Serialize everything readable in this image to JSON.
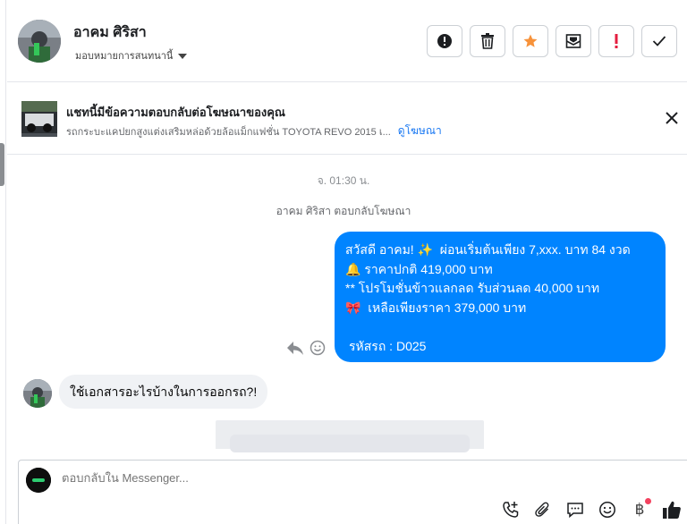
{
  "header": {
    "contact_name": "อาคม ศิริสา",
    "assign_label": "มอบหมายการสนทนานี้",
    "toolbar": [
      {
        "name": "follow-up-button",
        "icon": "exclamation-circle-icon"
      },
      {
        "name": "delete-button",
        "icon": "trash-icon"
      },
      {
        "name": "star-button",
        "icon": "star-icon"
      },
      {
        "name": "mark-unread-button",
        "icon": "envelope-icon"
      },
      {
        "name": "spam-button",
        "icon": "exclamation-icon"
      },
      {
        "name": "done-button",
        "icon": "checkmark-icon"
      }
    ]
  },
  "ad_banner": {
    "title": "แชทนี้มีข้อความตอบกลับต่อโฆษณาของคุณ",
    "subtitle": "รถกระบะแคปยกสูงแต่งเสริมหล่อด้วยล้อแม็กแฟชั่น TOYOTA REVO 2015 เ...",
    "link_label": "ดูโฆษณา"
  },
  "conversation": {
    "timestamp": "จ. 01:30 น.",
    "reply_note": "อาคม ศิริสา ตอบกลับโฆษณา",
    "outgoing": {
      "line1_a": "สวัสดี อาคม!",
      "line1_b": "ผ่อนเริ่มต้นเพียง 7,xxx. บาท 84 งวด",
      "line2": "ราคาปกติ 419,000 บาท",
      "line3": "** โปรโมชั่นข้าวแลกลด รับส่วนลด 40,000 บาท",
      "line4": "เหลือเพียงราคา 379,000 บาท",
      "line5": "รหัสรถ : D025",
      "emoji1": "✨",
      "emoji2": "🔔",
      "emoji3": "🎀"
    },
    "incoming": {
      "text": "ใช้เอกสารอะไรบ้างในการออกรถ?!"
    }
  },
  "composer": {
    "placeholder": "ตอบกลับใน Messenger...",
    "baht_symbol": "฿"
  },
  "colors": {
    "outgoing_bubble": "#0084ff",
    "incoming_bubble": "#f0f2f5",
    "star": "#f7923a",
    "spam": "#e41e3f",
    "link": "#1877f2"
  }
}
